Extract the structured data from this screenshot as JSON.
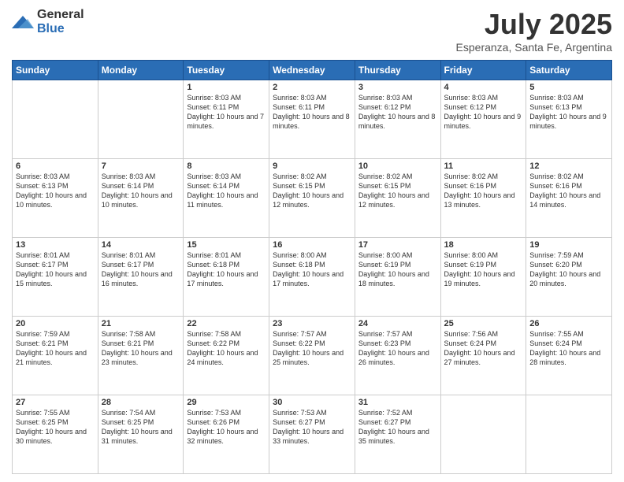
{
  "header": {
    "logo_general": "General",
    "logo_blue": "Blue",
    "title": "July 2025",
    "subtitle": "Esperanza, Santa Fe, Argentina"
  },
  "weekdays": [
    "Sunday",
    "Monday",
    "Tuesday",
    "Wednesday",
    "Thursday",
    "Friday",
    "Saturday"
  ],
  "weeks": [
    [
      {
        "day": "",
        "sunrise": "",
        "sunset": "",
        "daylight": ""
      },
      {
        "day": "",
        "sunrise": "",
        "sunset": "",
        "daylight": ""
      },
      {
        "day": "1",
        "sunrise": "Sunrise: 8:03 AM",
        "sunset": "Sunset: 6:11 PM",
        "daylight": "Daylight: 10 hours and 7 minutes."
      },
      {
        "day": "2",
        "sunrise": "Sunrise: 8:03 AM",
        "sunset": "Sunset: 6:11 PM",
        "daylight": "Daylight: 10 hours and 8 minutes."
      },
      {
        "day": "3",
        "sunrise": "Sunrise: 8:03 AM",
        "sunset": "Sunset: 6:12 PM",
        "daylight": "Daylight: 10 hours and 8 minutes."
      },
      {
        "day": "4",
        "sunrise": "Sunrise: 8:03 AM",
        "sunset": "Sunset: 6:12 PM",
        "daylight": "Daylight: 10 hours and 9 minutes."
      },
      {
        "day": "5",
        "sunrise": "Sunrise: 8:03 AM",
        "sunset": "Sunset: 6:13 PM",
        "daylight": "Daylight: 10 hours and 9 minutes."
      }
    ],
    [
      {
        "day": "6",
        "sunrise": "Sunrise: 8:03 AM",
        "sunset": "Sunset: 6:13 PM",
        "daylight": "Daylight: 10 hours and 10 minutes."
      },
      {
        "day": "7",
        "sunrise": "Sunrise: 8:03 AM",
        "sunset": "Sunset: 6:14 PM",
        "daylight": "Daylight: 10 hours and 10 minutes."
      },
      {
        "day": "8",
        "sunrise": "Sunrise: 8:03 AM",
        "sunset": "Sunset: 6:14 PM",
        "daylight": "Daylight: 10 hours and 11 minutes."
      },
      {
        "day": "9",
        "sunrise": "Sunrise: 8:02 AM",
        "sunset": "Sunset: 6:15 PM",
        "daylight": "Daylight: 10 hours and 12 minutes."
      },
      {
        "day": "10",
        "sunrise": "Sunrise: 8:02 AM",
        "sunset": "Sunset: 6:15 PM",
        "daylight": "Daylight: 10 hours and 12 minutes."
      },
      {
        "day": "11",
        "sunrise": "Sunrise: 8:02 AM",
        "sunset": "Sunset: 6:16 PM",
        "daylight": "Daylight: 10 hours and 13 minutes."
      },
      {
        "day": "12",
        "sunrise": "Sunrise: 8:02 AM",
        "sunset": "Sunset: 6:16 PM",
        "daylight": "Daylight: 10 hours and 14 minutes."
      }
    ],
    [
      {
        "day": "13",
        "sunrise": "Sunrise: 8:01 AM",
        "sunset": "Sunset: 6:17 PM",
        "daylight": "Daylight: 10 hours and 15 minutes."
      },
      {
        "day": "14",
        "sunrise": "Sunrise: 8:01 AM",
        "sunset": "Sunset: 6:17 PM",
        "daylight": "Daylight: 10 hours and 16 minutes."
      },
      {
        "day": "15",
        "sunrise": "Sunrise: 8:01 AM",
        "sunset": "Sunset: 6:18 PM",
        "daylight": "Daylight: 10 hours and 17 minutes."
      },
      {
        "day": "16",
        "sunrise": "Sunrise: 8:00 AM",
        "sunset": "Sunset: 6:18 PM",
        "daylight": "Daylight: 10 hours and 17 minutes."
      },
      {
        "day": "17",
        "sunrise": "Sunrise: 8:00 AM",
        "sunset": "Sunset: 6:19 PM",
        "daylight": "Daylight: 10 hours and 18 minutes."
      },
      {
        "day": "18",
        "sunrise": "Sunrise: 8:00 AM",
        "sunset": "Sunset: 6:19 PM",
        "daylight": "Daylight: 10 hours and 19 minutes."
      },
      {
        "day": "19",
        "sunrise": "Sunrise: 7:59 AM",
        "sunset": "Sunset: 6:20 PM",
        "daylight": "Daylight: 10 hours and 20 minutes."
      }
    ],
    [
      {
        "day": "20",
        "sunrise": "Sunrise: 7:59 AM",
        "sunset": "Sunset: 6:21 PM",
        "daylight": "Daylight: 10 hours and 21 minutes."
      },
      {
        "day": "21",
        "sunrise": "Sunrise: 7:58 AM",
        "sunset": "Sunset: 6:21 PM",
        "daylight": "Daylight: 10 hours and 23 minutes."
      },
      {
        "day": "22",
        "sunrise": "Sunrise: 7:58 AM",
        "sunset": "Sunset: 6:22 PM",
        "daylight": "Daylight: 10 hours and 24 minutes."
      },
      {
        "day": "23",
        "sunrise": "Sunrise: 7:57 AM",
        "sunset": "Sunset: 6:22 PM",
        "daylight": "Daylight: 10 hours and 25 minutes."
      },
      {
        "day": "24",
        "sunrise": "Sunrise: 7:57 AM",
        "sunset": "Sunset: 6:23 PM",
        "daylight": "Daylight: 10 hours and 26 minutes."
      },
      {
        "day": "25",
        "sunrise": "Sunrise: 7:56 AM",
        "sunset": "Sunset: 6:24 PM",
        "daylight": "Daylight: 10 hours and 27 minutes."
      },
      {
        "day": "26",
        "sunrise": "Sunrise: 7:55 AM",
        "sunset": "Sunset: 6:24 PM",
        "daylight": "Daylight: 10 hours and 28 minutes."
      }
    ],
    [
      {
        "day": "27",
        "sunrise": "Sunrise: 7:55 AM",
        "sunset": "Sunset: 6:25 PM",
        "daylight": "Daylight: 10 hours and 30 minutes."
      },
      {
        "day": "28",
        "sunrise": "Sunrise: 7:54 AM",
        "sunset": "Sunset: 6:25 PM",
        "daylight": "Daylight: 10 hours and 31 minutes."
      },
      {
        "day": "29",
        "sunrise": "Sunrise: 7:53 AM",
        "sunset": "Sunset: 6:26 PM",
        "daylight": "Daylight: 10 hours and 32 minutes."
      },
      {
        "day": "30",
        "sunrise": "Sunrise: 7:53 AM",
        "sunset": "Sunset: 6:27 PM",
        "daylight": "Daylight: 10 hours and 33 minutes."
      },
      {
        "day": "31",
        "sunrise": "Sunrise: 7:52 AM",
        "sunset": "Sunset: 6:27 PM",
        "daylight": "Daylight: 10 hours and 35 minutes."
      },
      {
        "day": "",
        "sunrise": "",
        "sunset": "",
        "daylight": ""
      },
      {
        "day": "",
        "sunrise": "",
        "sunset": "",
        "daylight": ""
      }
    ]
  ]
}
